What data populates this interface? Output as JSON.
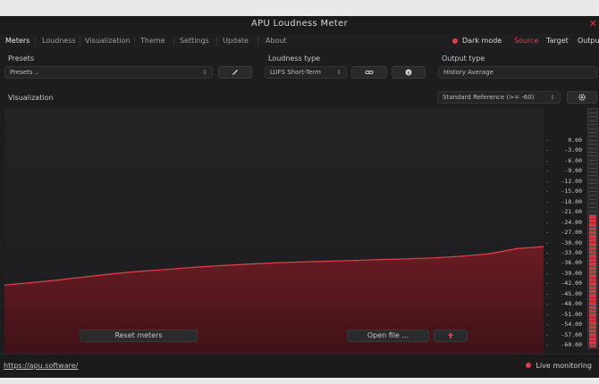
{
  "window": {
    "title": "APU Loudness Meter",
    "close_glyph": "✕"
  },
  "menu": {
    "items": [
      "Meters",
      "Loudness",
      "Visualization",
      "Theme",
      "Settings",
      "Update",
      "About"
    ],
    "active": "Meters",
    "dark_mode_label": "Dark mode",
    "source_label": "Source",
    "target_label": "Target",
    "output_label": "Output"
  },
  "presets": {
    "label": "Presets",
    "value": "Presets ..",
    "edit_icon": "pencil-icon"
  },
  "loudness_type": {
    "label": "Loudness type",
    "value": "LUFS Short-Term",
    "link_icon": "link-icon",
    "info_icon": "info-icon"
  },
  "output_type": {
    "label": "Output type",
    "value": "History Average"
  },
  "visualization": {
    "label": "Visualization",
    "reference_value": "Standard Reference (>= -60)",
    "settings_icon": "gear-icon"
  },
  "buttons": {
    "reset_meters": "Reset meters",
    "open_file": "Open file ...",
    "export_icon": "upload-icon"
  },
  "footer": {
    "link": "https://apu.software/",
    "live_monitoring": "Live monitoring"
  },
  "colors": {
    "accent": "#e03c48",
    "line": "#e0404a",
    "fill": "#5a1a20"
  },
  "chart_data": {
    "type": "area",
    "y_axis_ticks": [
      "0.00",
      "-3.00",
      "-6.00",
      "-9.00",
      "-12.00",
      "-15.00",
      "-18.00",
      "-21.00",
      "-24.00",
      "-27.00",
      "-30.00",
      "-33.00",
      "-36.00",
      "-39.00",
      "-42.00",
      "-45.00",
      "-48.00",
      "-51.00",
      "-54.00",
      "-57.00",
      "-60.00"
    ],
    "ylim": [
      -61,
      1
    ],
    "x": [
      0,
      0.05,
      0.1,
      0.15,
      0.2,
      0.25,
      0.3,
      0.35,
      0.4,
      0.45,
      0.5,
      0.55,
      0.6,
      0.65,
      0.7,
      0.75,
      0.8,
      0.85,
      0.9,
      0.95,
      1.0
    ],
    "series": [
      {
        "values": [
          -42.5,
          -41.8,
          -41.0,
          -40.1,
          -39.2,
          -38.5,
          -37.9,
          -37.3,
          -36.8,
          -36.4,
          -36.0,
          -35.7,
          -35.5,
          -35.3,
          -35.0,
          -34.8,
          -34.5,
          -34.0,
          -33.3,
          -31.8,
          -31.2
        ]
      }
    ]
  }
}
